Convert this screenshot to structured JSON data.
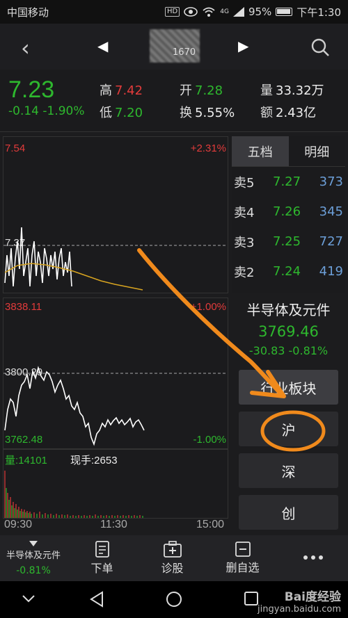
{
  "status_bar": {
    "carrier": "中国移动",
    "hd": "HD",
    "signal": "4G",
    "battery": "95%",
    "time": "下午1:30"
  },
  "header": {
    "stock_code_partial": "1670"
  },
  "quote": {
    "price": "7.23",
    "change": "-0.14 -1.90%",
    "high_label": "高",
    "high": "7.42",
    "low_label": "低",
    "low": "7.20",
    "open_label": "开",
    "open": "7.28",
    "turnover_label": "换",
    "turnover": "5.55%",
    "volume_label": "量",
    "volume": "33.32万",
    "amount_label": "额",
    "amount": "2.43亿"
  },
  "intraday": {
    "top_price": "7.54",
    "top_pct": "+2.31%",
    "mid_price": "7.37"
  },
  "orderbook": {
    "tabs": [
      "五档",
      "明细"
    ],
    "rows": [
      {
        "label": "卖5",
        "price": "7.27",
        "volume": "373"
      },
      {
        "label": "卖4",
        "price": "7.26",
        "volume": "345"
      },
      {
        "label": "卖3",
        "price": "7.25",
        "volume": "727"
      },
      {
        "label": "卖2",
        "price": "7.24",
        "volume": "419"
      }
    ]
  },
  "index_chart": {
    "top_value": "3838.11",
    "top_pct": "+1.00%",
    "mid_value": "3800.29",
    "bottom_value": "3762.48",
    "bottom_pct": "-1.00%"
  },
  "volume": {
    "volume_text": "量:14101",
    "current_text": "现手:2653"
  },
  "time_axis": [
    "09:30",
    "11:30",
    "15:00"
  ],
  "sector": {
    "name": "半导体及元件",
    "price": "3769.46",
    "change": "-30.83  -0.81%",
    "buttons": [
      "行业板块",
      "沪",
      "深",
      "创"
    ]
  },
  "toolbar": {
    "sector_name": "半导体及元件",
    "sector_chg": "-0.81%",
    "items": [
      "下单",
      "诊股",
      "删自选"
    ]
  },
  "watermark": {
    "brand": "Bai度经验",
    "url": "jingyan.baidu.com"
  },
  "colors": {
    "up": "#e23b3b",
    "down": "#2eb82e",
    "volume_blue": "#6c9fd8",
    "annotation_orange": "#f08a1c"
  }
}
